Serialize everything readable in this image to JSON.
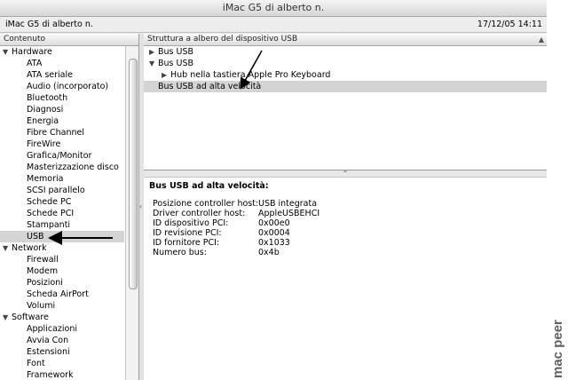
{
  "window": {
    "title": "iMac G5 di alberto n."
  },
  "infobar": {
    "machine": "iMac G5 di alberto n.",
    "datetime": "17/12/05 14:11"
  },
  "sidebar": {
    "header": "Contenuto",
    "sections": [
      {
        "label": "Hardware",
        "items": [
          "ATA",
          "ATA seriale",
          "Audio (incorporato)",
          "Bluetooth",
          "Diagnosi",
          "Energia",
          "Fibre Channel",
          "FireWire",
          "Grafica/Monitor",
          "Masterizzazione disco",
          "Memoria",
          "SCSI parallelo",
          "Schede PC",
          "Schede PCI",
          "Stampanti",
          "USB"
        ]
      },
      {
        "label": "Network",
        "items": [
          "Firewall",
          "Modem",
          "Posizioni",
          "Scheda AirPort",
          "Volumi"
        ]
      },
      {
        "label": "Software",
        "items": [
          "Applicazioni",
          "Avvia Con",
          "Estensioni",
          "Font",
          "Framework"
        ]
      }
    ],
    "selected": "USB"
  },
  "tree": {
    "header": "Struttura a albero del dispositivo USB",
    "rows": {
      "bus1": "Bus USB",
      "bus2": "Bus USB",
      "hub": "Hub nella tastiera Apple Pro Keyboard",
      "highspeed": "Bus USB ad alta velocità"
    }
  },
  "detail": {
    "title": "Bus USB ad alta velocità:",
    "properties": [
      {
        "key": "Posizione controller host:",
        "value": "USB integrata"
      },
      {
        "key": "Driver controller host:",
        "value": "AppleUSBEHCI"
      },
      {
        "key": "ID dispositivo PCI:",
        "value": "0x00e0"
      },
      {
        "key": "ID revisione PCI:",
        "value": "0x0004"
      },
      {
        "key": "ID fornitore PCI:",
        "value": "0x1033"
      },
      {
        "key": "Numero bus:",
        "value": "0x4b"
      }
    ]
  },
  "watermark": {
    "text": "mac peer"
  },
  "colors": {
    "selection": "#d4d4d4",
    "arrow": "#000000"
  }
}
